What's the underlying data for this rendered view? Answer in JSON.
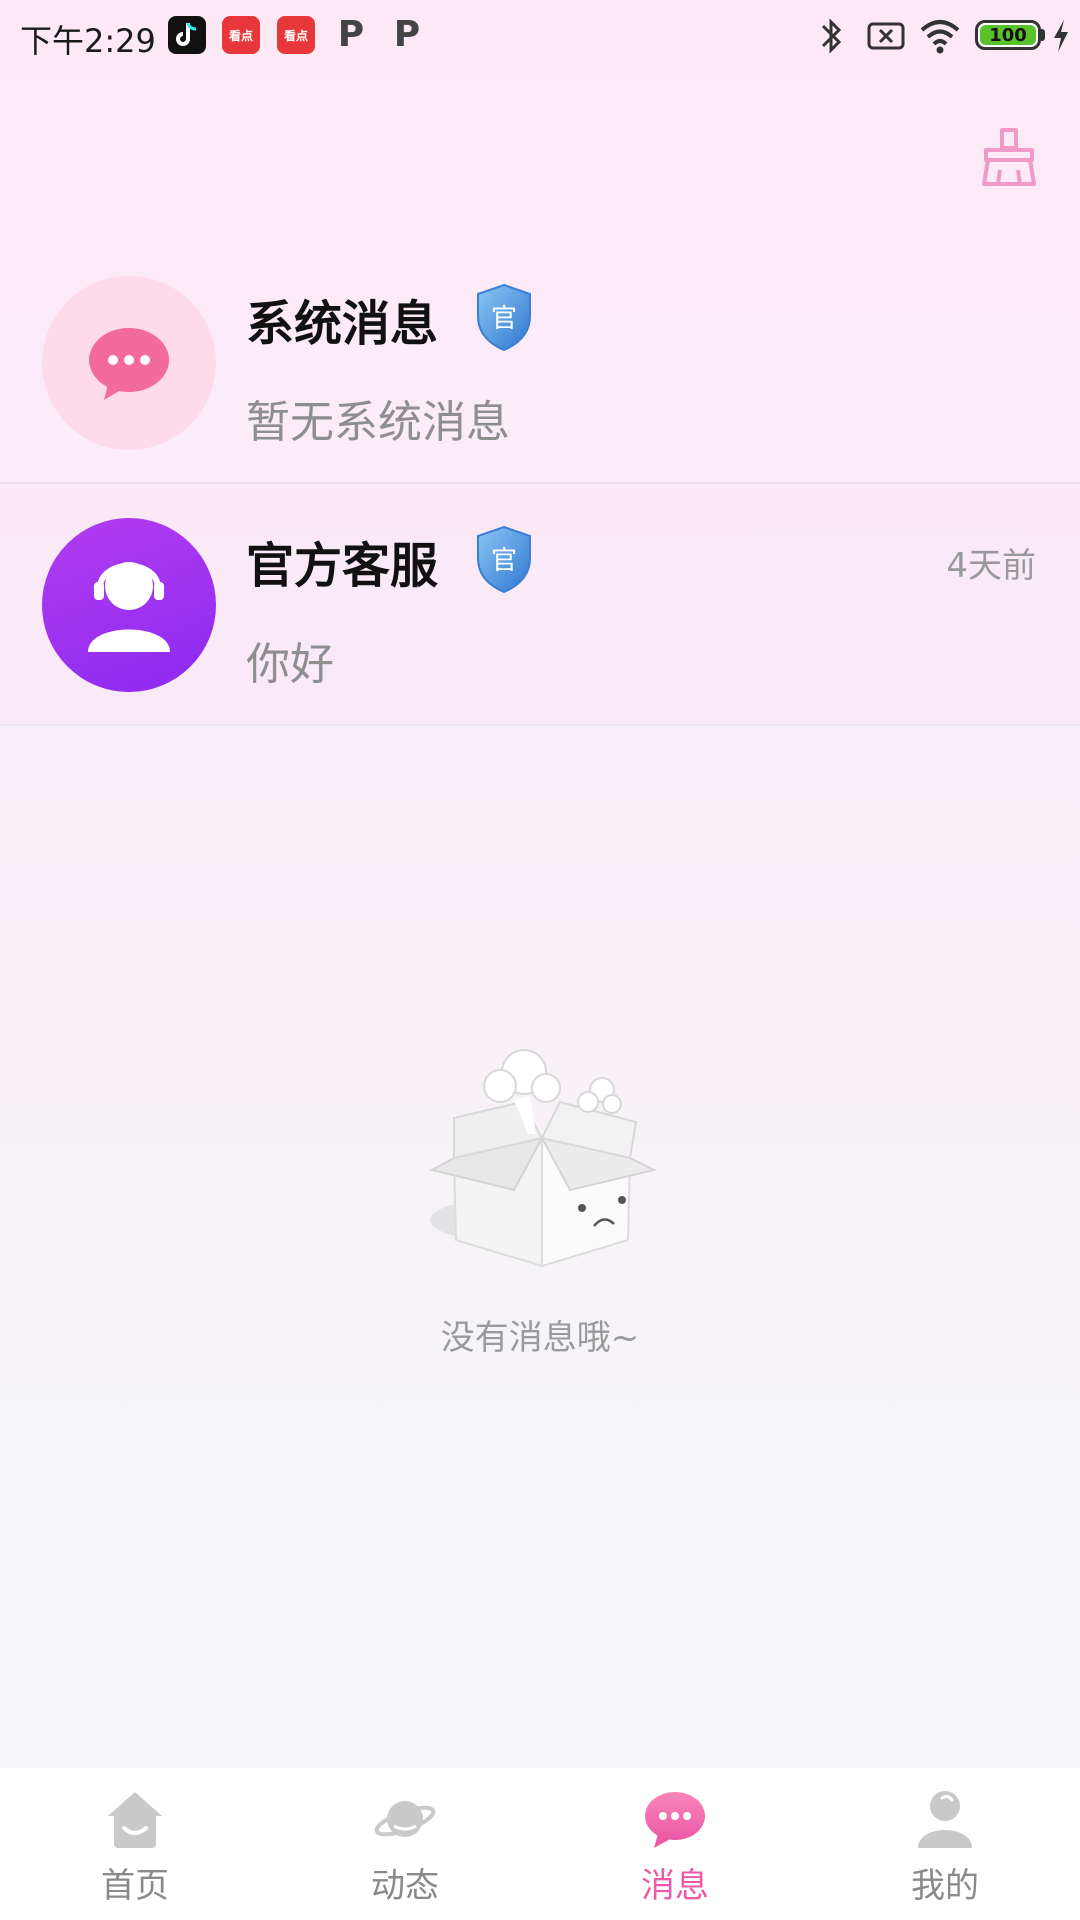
{
  "status_bar": {
    "time": "下午2:29",
    "battery_level": "100",
    "app_icons": [
      "tiktok-icon",
      "kandian-icon",
      "kandian-icon",
      "p-icon",
      "p-icon"
    ],
    "app_kandian_label": "看点",
    "app_p_label": "P"
  },
  "toolbar": {
    "clean_icon": "broom-icon"
  },
  "conversations": [
    {
      "title": "系统消息",
      "preview": "暂无系统消息",
      "time": "",
      "badge_text": "官",
      "avatar_icon": "chat-bubble-icon"
    },
    {
      "title": "官方客服",
      "preview": "你好",
      "time": "4天前",
      "badge_text": "官",
      "avatar_icon": "headset-user-icon"
    }
  ],
  "empty_state": {
    "text": "没有消息哦~",
    "illustration": "empty-box-icon"
  },
  "tab_bar": {
    "tabs": [
      {
        "label": "首页",
        "icon": "home-icon",
        "active": false
      },
      {
        "label": "动态",
        "icon": "planet-icon",
        "active": false
      },
      {
        "label": "消息",
        "icon": "message-icon",
        "active": true
      },
      {
        "label": "我的",
        "icon": "user-icon",
        "active": false
      }
    ]
  },
  "colors": {
    "accent": "#ec5aa8",
    "badge_blue": "#4a90e2",
    "cs_avatar": "#9a2ef0"
  }
}
